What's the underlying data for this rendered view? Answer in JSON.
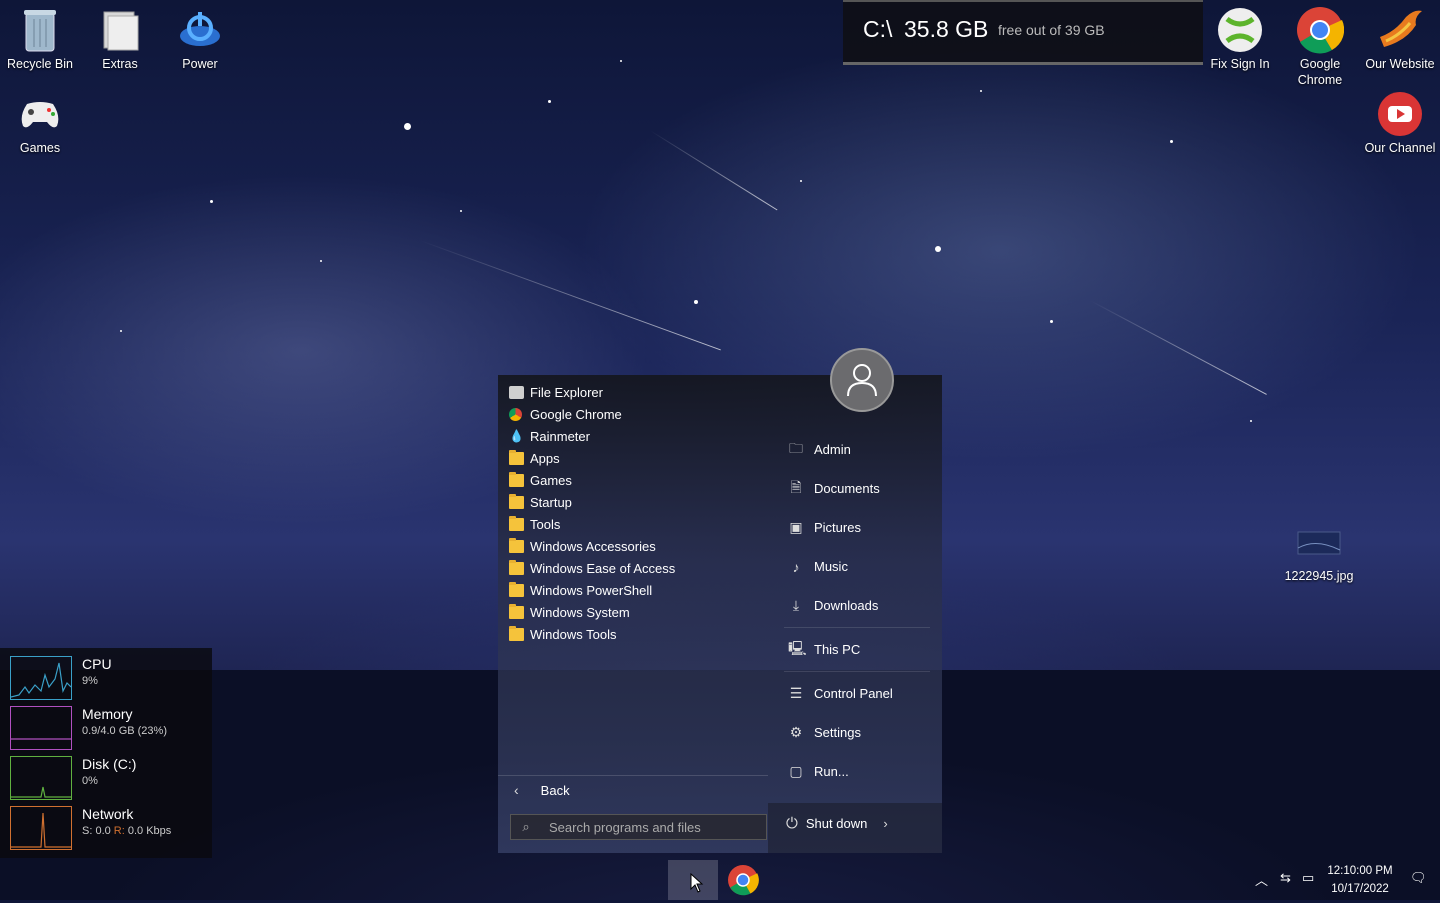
{
  "desktop": {
    "icons_left": [
      {
        "label": "Recycle Bin",
        "icon": "recycle-bin-icon"
      },
      {
        "label": "Extras",
        "icon": "folder-stack-icon"
      },
      {
        "label": "Power",
        "icon": "power-icon"
      },
      {
        "label": "Games",
        "icon": "gamepad-icon"
      }
    ],
    "icons_right": [
      {
        "label": "Fix Sign In",
        "icon": "xbox-icon"
      },
      {
        "label": "Google Chrome",
        "icon": "chrome-icon"
      },
      {
        "label": "Our Website",
        "icon": "phoenix-icon"
      },
      {
        "label": "Our Channel",
        "icon": "youtube-icon"
      }
    ],
    "file": {
      "label": "1222945.jpg",
      "icon": "image-file-icon"
    }
  },
  "drive": {
    "letter": "C:\\",
    "size": "35.8 GB",
    "free_text": "free out of 39 GB"
  },
  "perf": [
    {
      "name": "CPU",
      "value": "9%",
      "color": "#3aa0c8"
    },
    {
      "name": "Memory",
      "value": "0.9/4.0 GB (23%)",
      "color": "#b050c0"
    },
    {
      "name": "Disk (C:)",
      "value": "0%",
      "color": "#60b040"
    },
    {
      "name": "Network",
      "value_prefix": "S: 0.0 ",
      "value_r": "R:",
      "value_suffix": " 0.0 Kbps",
      "color": "#d07030"
    }
  ],
  "start_menu": {
    "programs": [
      {
        "label": "File Explorer",
        "icon": "file-explorer-icon"
      },
      {
        "label": "Google Chrome",
        "icon": "chrome-icon"
      },
      {
        "label": "Rainmeter",
        "icon": "rainmeter-icon"
      },
      {
        "label": "Apps",
        "icon": "folder-icon"
      },
      {
        "label": "Games",
        "icon": "folder-icon"
      },
      {
        "label": "Startup",
        "icon": "folder-icon"
      },
      {
        "label": "Tools",
        "icon": "folder-icon"
      },
      {
        "label": "Windows Accessories",
        "icon": "folder-icon"
      },
      {
        "label": "Windows Ease of Access",
        "icon": "folder-icon"
      },
      {
        "label": "Windows PowerShell",
        "icon": "folder-icon"
      },
      {
        "label": "Windows System",
        "icon": "folder-icon"
      },
      {
        "label": "Windows Tools",
        "icon": "folder-icon"
      }
    ],
    "back_label": "Back",
    "search_placeholder": "Search programs and files",
    "places": [
      {
        "label": "Admin",
        "icon": "user-folder-icon"
      },
      {
        "label": "Documents",
        "icon": "document-icon"
      },
      {
        "label": "Pictures",
        "icon": "picture-icon"
      },
      {
        "label": "Music",
        "icon": "music-icon"
      },
      {
        "label": "Downloads",
        "icon": "download-icon"
      },
      {
        "label": "This PC",
        "icon": "pc-icon"
      },
      {
        "label": "Control Panel",
        "icon": "control-panel-icon"
      },
      {
        "label": "Settings",
        "icon": "gear-icon"
      },
      {
        "label": "Run...",
        "icon": "run-icon"
      }
    ],
    "shutdown_label": "Shut down"
  },
  "taskbar": {
    "clock_time": "12:10:00 PM",
    "clock_date": "10/17/2022"
  }
}
